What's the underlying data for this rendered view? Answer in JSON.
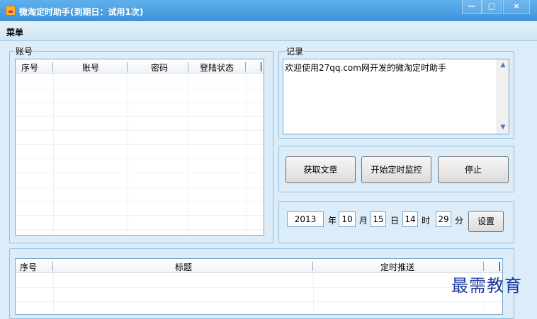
{
  "window": {
    "title": "微淘定时助手(到期日：试用1次)",
    "controls": {
      "minimize": "—",
      "maximize": "□",
      "close": "×"
    }
  },
  "menu": {
    "items": [
      "菜单"
    ]
  },
  "accounts": {
    "group_label": "账号",
    "columns": [
      "序号",
      "账号",
      "密码",
      "登陆状态"
    ],
    "rows": []
  },
  "log": {
    "group_label": "记录",
    "text": "欢迎使用27qq.com网开发的微淘定时助手"
  },
  "actions": {
    "fetch_label": "获取文章",
    "start_label": "开始定时监控",
    "stop_label": "停止"
  },
  "schedule": {
    "year": "2013",
    "year_unit": "年",
    "month": "10",
    "month_unit": "月",
    "day": "15",
    "day_unit": "日",
    "hour": "14",
    "hour_unit": "时",
    "minute": "29",
    "minute_unit": "分",
    "set_label": "设置"
  },
  "articles": {
    "columns": [
      "序号",
      "标题",
      "定时推送"
    ],
    "rows": []
  },
  "watermark": "最需教育"
}
